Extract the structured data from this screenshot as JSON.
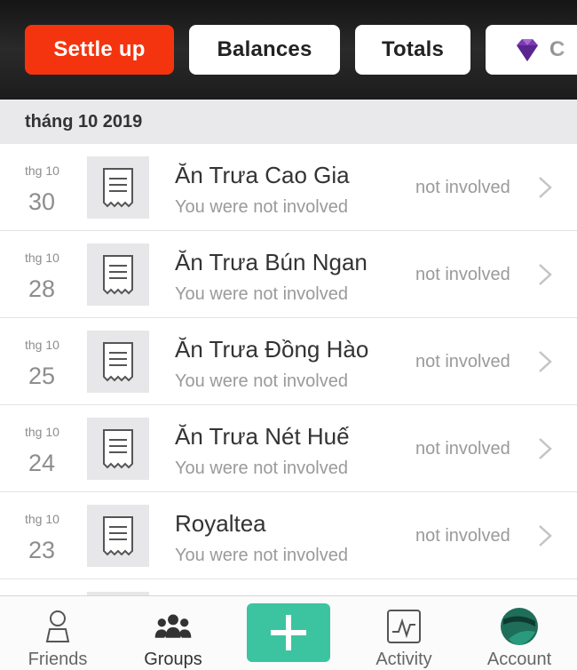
{
  "toolbar": {
    "settle_up": "Settle up",
    "balances": "Balances",
    "totals": "Totals",
    "charts_partial": "C",
    "accent": "#f4340f"
  },
  "month_header": "tháng 10 2019",
  "expenses": [
    {
      "month": "thg 10",
      "day": "30",
      "title": "Ăn Trưa Cao Gia",
      "subtitle": "You were not involved",
      "status": "not involved"
    },
    {
      "month": "thg 10",
      "day": "28",
      "title": "Ăn Trưa Bún Ngan",
      "subtitle": "You were not involved",
      "status": "not involved"
    },
    {
      "month": "thg 10",
      "day": "25",
      "title": "Ăn Trưa Đồng Hào",
      "subtitle": "You were not involved",
      "status": "not involved"
    },
    {
      "month": "thg 10",
      "day": "24",
      "title": "Ăn Trưa Nét Huế",
      "subtitle": "You were not involved",
      "status": "not involved"
    },
    {
      "month": "thg 10",
      "day": "23",
      "title": "Royaltea",
      "subtitle": "You were not involved",
      "status": "not involved"
    }
  ],
  "tabs": {
    "friends": "Friends",
    "groups": "Groups",
    "activity": "Activity",
    "account": "Account",
    "add_color": "#3cc4a0"
  },
  "icons": {
    "receipt": "receipt-icon",
    "chevron": "chevron-right-icon",
    "gem": "gem-icon",
    "friends": "person-icon",
    "groups": "people-icon",
    "add": "plus-icon",
    "activity": "activity-chart-icon",
    "account": "avatar-icon"
  }
}
